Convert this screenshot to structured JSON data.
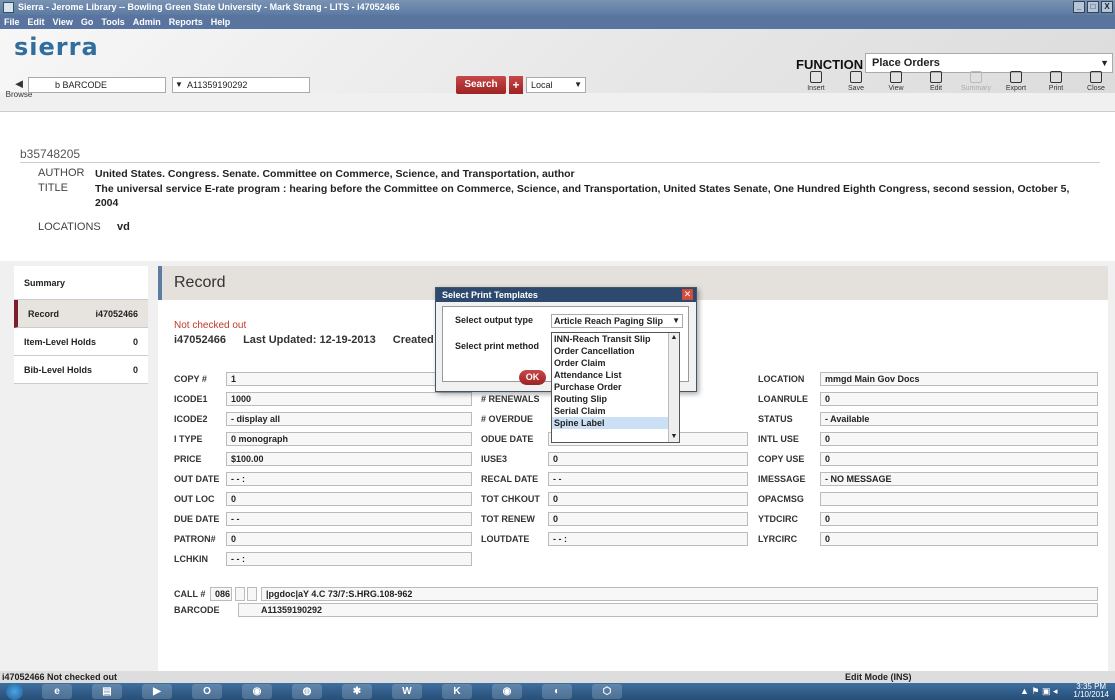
{
  "window": {
    "title": "Sierra - Jerome Library -- Bowling Green State University - Mark Strang - LITS - i47052466",
    "controls": [
      "_",
      "□",
      "X"
    ]
  },
  "menu": [
    "File",
    "Edit",
    "View",
    "Go",
    "Tools",
    "Admin",
    "Reports",
    "Help"
  ],
  "header": {
    "logo": "sierra",
    "function_label": "FUNCTION",
    "function_value": "Place Orders"
  },
  "search": {
    "browse_label": "Browse",
    "index": "b BARCODE",
    "query": "A11359190292",
    "search_button": "Search",
    "plus_button": "+",
    "scope": "Local"
  },
  "toolbar": [
    {
      "label": "Insert",
      "icon": "insert-icon",
      "enabled": true
    },
    {
      "label": "Save",
      "icon": "save-icon",
      "enabled": true
    },
    {
      "label": "View",
      "icon": "view-icon",
      "enabled": true
    },
    {
      "label": "Edit",
      "icon": "edit-icon",
      "enabled": true
    },
    {
      "label": "Summary",
      "icon": "summary-icon",
      "enabled": false
    },
    {
      "label": "Export",
      "icon": "export-icon",
      "enabled": true
    },
    {
      "label": "Print",
      "icon": "print-icon",
      "enabled": true
    },
    {
      "label": "Close",
      "icon": "close-icon",
      "enabled": true
    }
  ],
  "bib": {
    "record_id": "b35748205",
    "author_label": "AUTHOR",
    "author": "United States. Congress. Senate. Committee on Commerce, Science, and Transportation, author",
    "title_label": "TITLE",
    "title": "The universal service E-rate program : hearing before the Committee on Commerce, Science, and Transportation, United States Senate, One Hundred Eighth Congress, second session, October 5, 2004",
    "locations_label": "LOCATIONS",
    "locations": "vd"
  },
  "nav": [
    {
      "label": "Summary",
      "count": ""
    },
    {
      "label": "Record",
      "count": "i47052466"
    },
    {
      "label": "Item-Level Holds",
      "count": "0"
    },
    {
      "label": "Bib-Level Holds",
      "count": "0"
    }
  ],
  "record": {
    "heading": "Record",
    "status": "Not checked out",
    "item_id": "i47052466",
    "last_updated": "Last Updated: 12-19-2013",
    "created": "Created"
  },
  "fields_left": [
    {
      "label": "COPY #",
      "value": "1"
    },
    {
      "label": "ICODE1",
      "value": "1000"
    },
    {
      "label": "ICODE2",
      "value": "- display all"
    },
    {
      "label": "I TYPE",
      "value": "0 monograph"
    },
    {
      "label": "PRICE",
      "value": "$100.00"
    },
    {
      "label": "OUT DATE",
      "value": "- -     :"
    },
    {
      "label": "OUT LOC",
      "value": "0"
    },
    {
      "label": "DUE DATE",
      "value": "- -"
    },
    {
      "label": "PATRON#",
      "value": "0"
    },
    {
      "label": "LCHKIN",
      "value": "- -     :"
    }
  ],
  "fields_mid": [
    {
      "label": "# RENEWALS",
      "value": ""
    },
    {
      "label": "# OVERDUE",
      "value": ""
    },
    {
      "label": "ODUE DATE",
      "value": ""
    },
    {
      "label": "IUSE3",
      "value": "0"
    },
    {
      "label": "RECAL DATE",
      "value": "- -"
    },
    {
      "label": "TOT CHKOUT",
      "value": "0"
    },
    {
      "label": "TOT RENEW",
      "value": "0"
    },
    {
      "label": "LOUTDATE",
      "value": "- -     :"
    }
  ],
  "fields_right": [
    {
      "label": "LOCATION",
      "value": "mmgd   Main Gov Docs"
    },
    {
      "label": "LOANRULE",
      "value": "0"
    },
    {
      "label": "STATUS",
      "value": "- Available"
    },
    {
      "label": "INTL USE",
      "value": "0"
    },
    {
      "label": "COPY USE",
      "value": "0"
    },
    {
      "label": "IMESSAGE",
      "value": "- NO MESSAGE"
    },
    {
      "label": "OPACMSG",
      "value": ""
    },
    {
      "label": "YTDCIRC",
      "value": "0"
    },
    {
      "label": "LYRCIRC",
      "value": "0"
    }
  ],
  "call": {
    "label": "CALL #",
    "tag": "086",
    "value": "|pgdoc|aY 4.C 73/7:S.HRG.108-962",
    "barcode_label": "BARCODE",
    "barcode": "A11359190292"
  },
  "dialog": {
    "title": "Select Print Templates",
    "output_label": "Select output type",
    "output_value": "Article Reach Paging Slip",
    "method_label": "Select print method",
    "ok_label": "OK",
    "options": [
      "INN-Reach Transit Slip",
      "Order Cancellation",
      "Order Claim",
      "Attendance List",
      "Purchase Order",
      "Routing Slip",
      "Serial Claim",
      "Spine Label"
    ],
    "highlighted": "Spine Label"
  },
  "statusbar": {
    "left": "i47052466 Not checked out",
    "right": "Edit Mode (INS)"
  },
  "taskbar": {
    "time": "3:35 PM",
    "date": "1/10/2014"
  }
}
